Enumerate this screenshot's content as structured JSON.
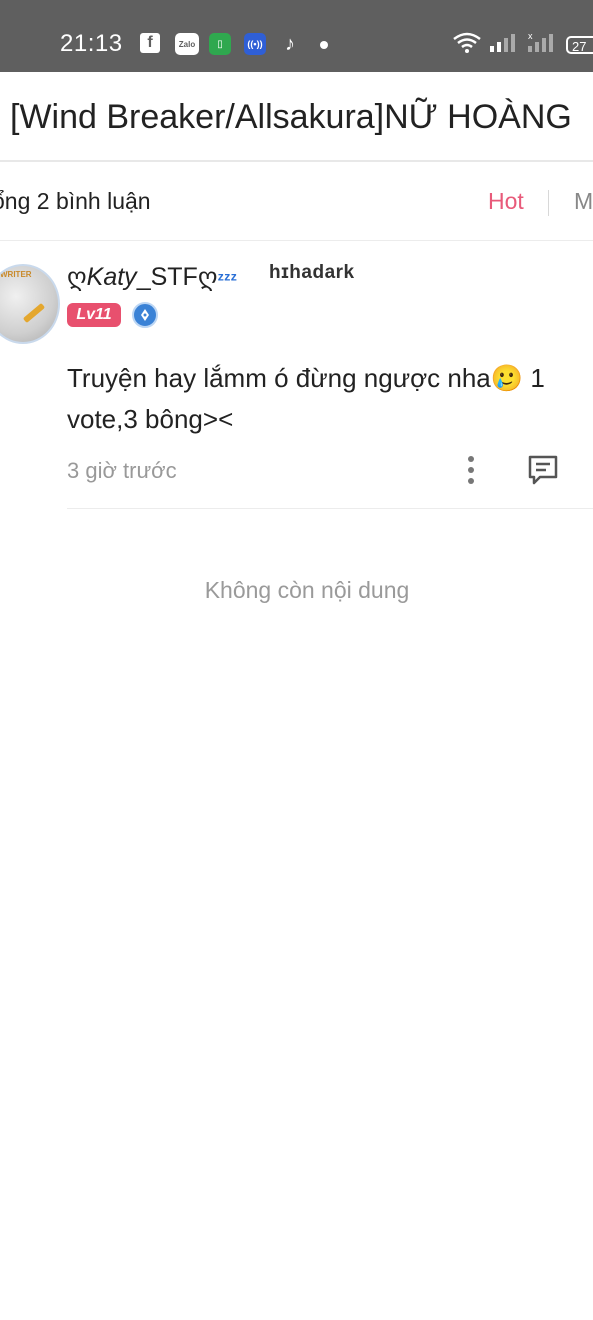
{
  "status_bar": {
    "time": "21:13",
    "zalo_label": "Zalo",
    "battery": "27"
  },
  "header": {
    "title": "[Wind Breaker/Allsakura]NỮ HOÀNG"
  },
  "comments_header": {
    "total": "ổng 2 bình luận",
    "sort_hot": "Hot",
    "sort_new": "M"
  },
  "comment": {
    "username_prefix": "ღ",
    "username_italic": "Katy",
    "username_rest": "_STF",
    "username_suffix": "ღ",
    "username_zzz": "ᶻᶻᶻ",
    "badge_text": "hɪhadark",
    "avatar_text": "WRITER",
    "level": "Lv11",
    "content": "Truyện hay lắmm ó đừng ngược nha🥲 1 vote,3 bông><",
    "time_ago": "3 giờ trước"
  },
  "footer": {
    "no_more": "Không còn nội dung"
  },
  "colors": {
    "status_bar": "#5f5f5f",
    "accent_pink": "#e85a7a",
    "level_badge": "#e8506e",
    "medal_blue": "#3a82d6"
  }
}
